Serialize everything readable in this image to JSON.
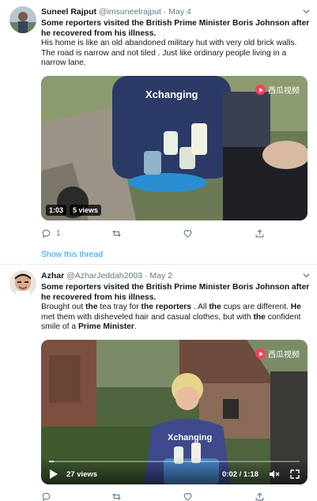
{
  "tweets": [
    {
      "name": "Suneel Rajput",
      "handle": "@imsuneelrajput",
      "separator": "·",
      "date": "May 4",
      "text_line1": "Some reporters visited the British Prime Minister Boris Johnson after he recovered from his illness.",
      "text_line2": "His home is like an old abandoned military hut with very old brick walls. The road is narrow and not tiled . Just like ordinary people living in a narrow lane.",
      "media": {
        "watermark": "西瓜视频",
        "shirt_text": "Xchanging",
        "duration": "1:03",
        "views": "5 views"
      },
      "actions": {
        "reply_count": "1",
        "retweet_count": "",
        "like_count": ""
      },
      "show_thread": "Show this thread",
      "avatar_color": "#8fa2b8"
    },
    {
      "name": "Azhar",
      "handle": "@AzharJeddah2003",
      "separator": "·",
      "date": "May 2",
      "text_line1": "Some reporters visited the British Prime Minister Boris Johnson after he recovered from his illness.",
      "text_line2_parts": [
        " Brought out ",
        "the",
        " tea tray for ",
        "the reporters",
        " . All ",
        "the",
        " cups are different. ",
        "He",
        " met them with disheveled hair and casual clothes, but with ",
        "the",
        " confident smile of a ",
        "Prime Minister",
        "."
      ],
      "media": {
        "watermark": "西瓜视频",
        "shirt_text": "Xchanging",
        "views": "27 views",
        "time": "0:02 / 1:18",
        "progress_fraction": 0.02
      },
      "actions": {
        "reply_count": "",
        "retweet_count": "",
        "like_count": ""
      },
      "avatar_color": "#c9b7a6"
    }
  ],
  "colors": {
    "accent": "#1da1f2",
    "muted": "#657786",
    "text": "#14171a",
    "divider": "#e6ecf0",
    "watermark_red": "#ff3d5a"
  },
  "icons": [
    "chevron-down-icon",
    "reply-icon",
    "retweet-icon",
    "like-icon",
    "share-icon",
    "play-icon",
    "mute-icon",
    "fullscreen-icon"
  ]
}
